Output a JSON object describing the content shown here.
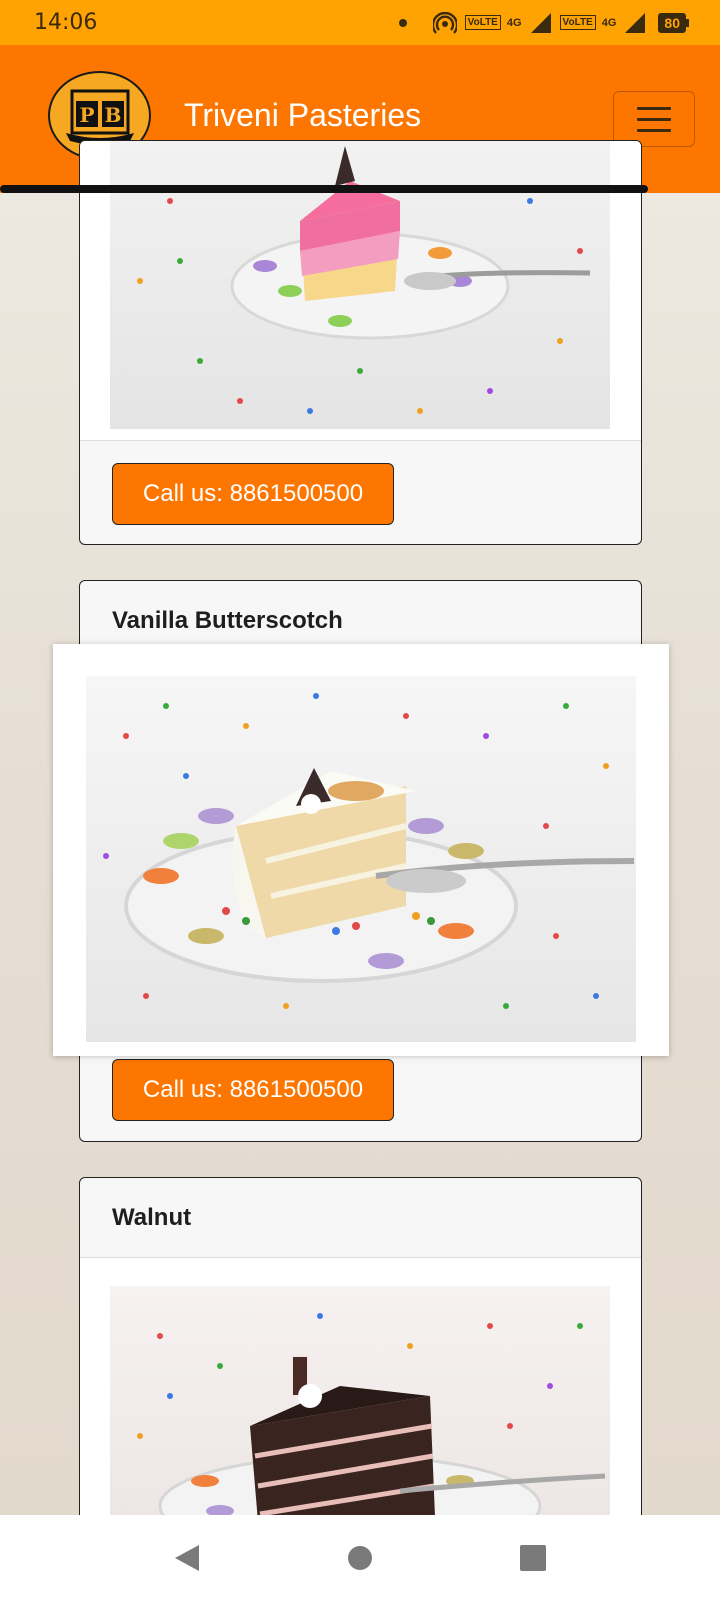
{
  "status_bar": {
    "time": "14:06",
    "network_1": "4G",
    "network_2": "4G",
    "volte_1": "VoLTE",
    "volte_2": "VoLTE",
    "battery": "80"
  },
  "navbar": {
    "brand": "Triveni Pasteries",
    "logo_text": "PB",
    "menu_icon": "hamburger-icon",
    "accent": "#fd7600"
  },
  "products": [
    {
      "title": "",
      "call_label": "Call us: 8861500500",
      "image": "strawberry-cake-slice"
    },
    {
      "title": "Vanilla Butterscotch",
      "call_label": "Call us: 8861500500",
      "image": "vanilla-butterscotch-cake-slice"
    },
    {
      "title": "Walnut",
      "image": "chocolate-walnut-cake-slice"
    }
  ],
  "system_nav": {
    "back": "back-icon",
    "home": "home-icon",
    "recents": "recents-icon"
  }
}
